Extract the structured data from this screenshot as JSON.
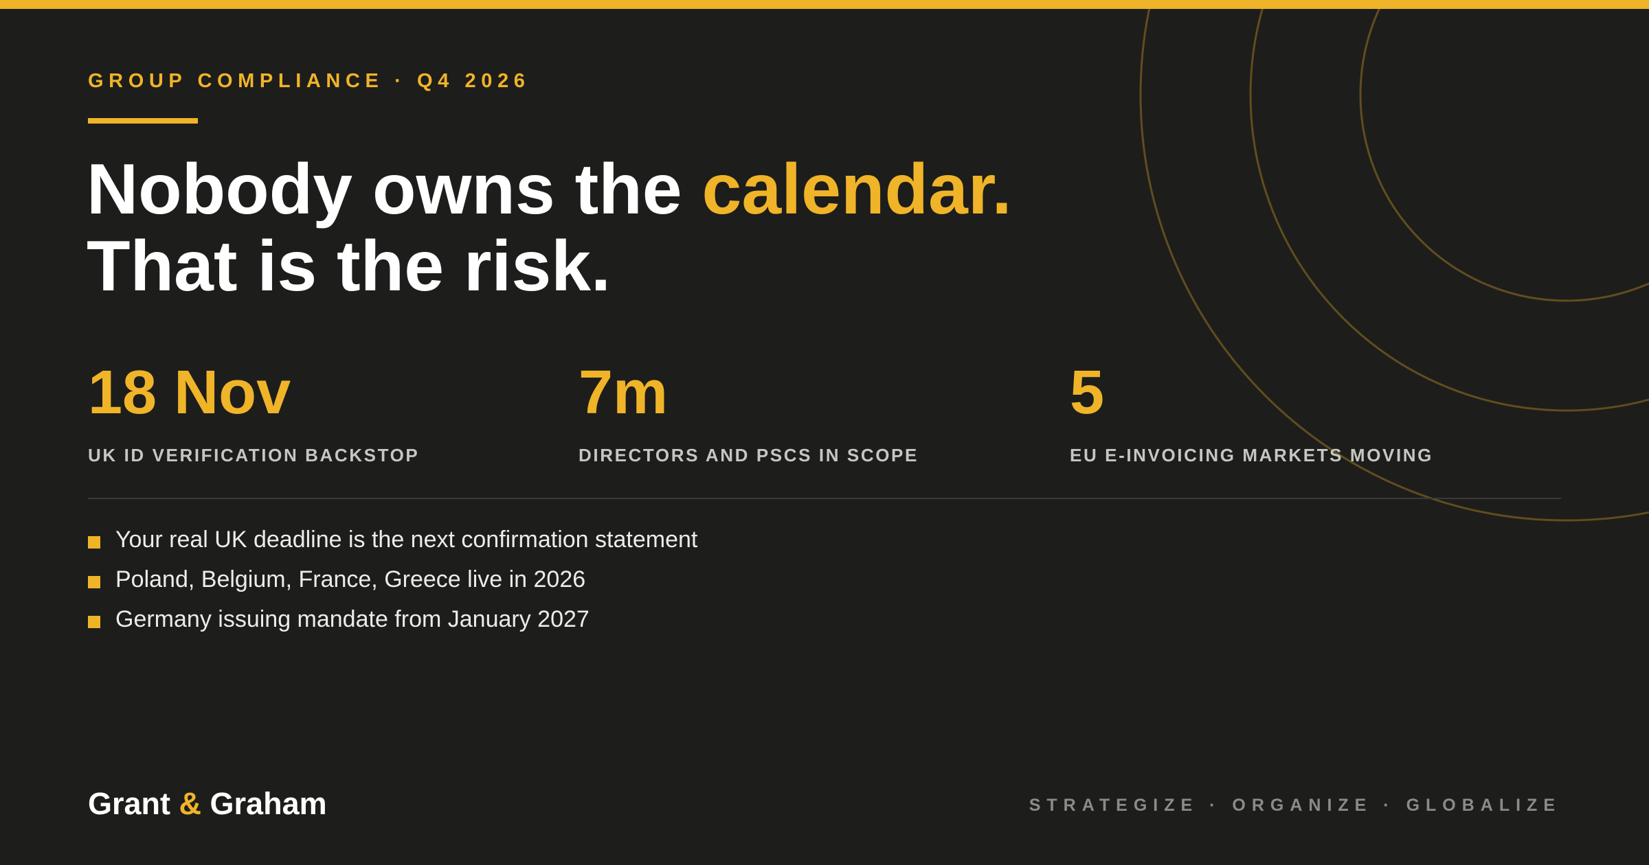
{
  "eyebrow": "GROUP COMPLIANCE · Q4 2026",
  "headline": {
    "line1_start": "Nobody owns the ",
    "line1_accent": "calendar.",
    "line2": "That is the risk."
  },
  "stats": [
    {
      "value": "18 Nov",
      "label": "UK ID VERIFICATION BACKSTOP"
    },
    {
      "value": "7m",
      "label": "DIRECTORS AND PSCS IN SCOPE"
    },
    {
      "value": "5",
      "label": "EU E-INVOICING MARKETS MOVING"
    }
  ],
  "bullets": [
    "Your real UK deadline is the next confirmation statement",
    "Poland, Belgium, France, Greece live in 2026",
    "Germany issuing mandate from January 2027"
  ],
  "brand": {
    "part1": "Grant ",
    "amp": "&",
    "part2": " Graham"
  },
  "tagline": "STRATEGIZE · ORGANIZE · GLOBALIZE",
  "colors": {
    "background": "#1d1d1b",
    "accent": "#f0b429",
    "text": "#ffffff",
    "muted": "#c6c6c2"
  }
}
